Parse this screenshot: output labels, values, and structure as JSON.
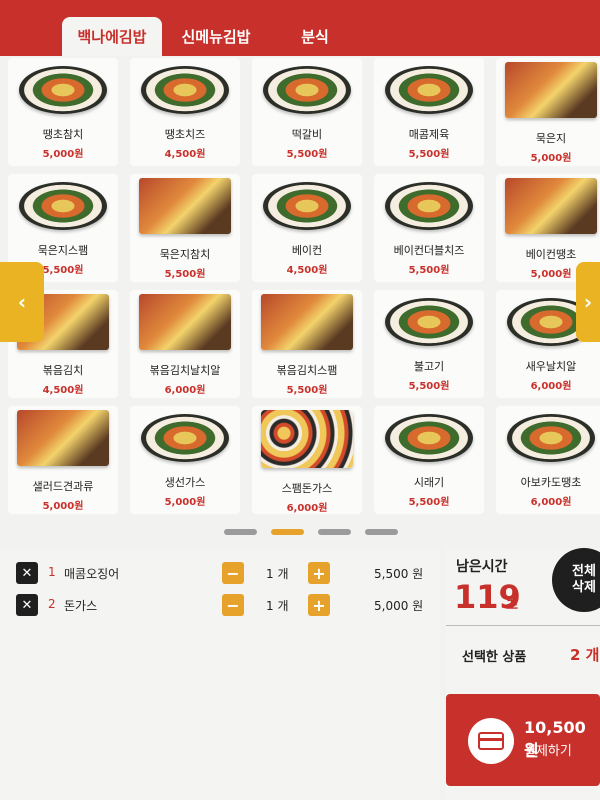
{
  "tabs": [
    {
      "label": "백나에김밥"
    },
    {
      "label": "신메뉴김밥"
    },
    {
      "label": "분식"
    }
  ],
  "menu": [
    {
      "name": "땡초참치",
      "price": "5,000원",
      "img": "roll"
    },
    {
      "name": "땡초치즈",
      "price": "4,500원",
      "img": "roll"
    },
    {
      "name": "떡갈비",
      "price": "5,500원",
      "img": "roll"
    },
    {
      "name": "매콤제육",
      "price": "5,500원",
      "img": "roll"
    },
    {
      "name": "묵은지",
      "price": "5,000원",
      "img": "rect"
    },
    {
      "name": "묵은지스팸",
      "price": "5,500원",
      "img": "roll"
    },
    {
      "name": "묵은지참치",
      "price": "5,500원",
      "img": "rect"
    },
    {
      "name": "베이컨",
      "price": "4,500원",
      "img": "roll"
    },
    {
      "name": "베이컨더블치즈",
      "price": "5,500원",
      "img": "roll"
    },
    {
      "name": "베이컨땡초",
      "price": "5,000원",
      "img": "rect"
    },
    {
      "name": "볶음김치",
      "price": "4,500원",
      "img": "rect"
    },
    {
      "name": "볶음김치날치알",
      "price": "6,000원",
      "img": "rect"
    },
    {
      "name": "볶음김치스팸",
      "price": "5,500원",
      "img": "rect"
    },
    {
      "name": "불고기",
      "price": "5,500원",
      "img": "roll"
    },
    {
      "name": "새우날치알",
      "price": "6,000원",
      "img": "roll"
    },
    {
      "name": "샐러드견과류",
      "price": "5,000원",
      "img": "rect"
    },
    {
      "name": "생선가스",
      "price": "5,000원",
      "img": "roll"
    },
    {
      "name": "스팸돈가스",
      "price": "6,000원",
      "img": "platter"
    },
    {
      "name": "시래기",
      "price": "5,500원",
      "img": "roll"
    },
    {
      "name": "아보카도땡초",
      "price": "6,000원",
      "img": "roll"
    }
  ],
  "pagination": {
    "active_index": 1
  },
  "order": [
    {
      "index": "1",
      "name": "매콤오징어",
      "qty": "1 개",
      "price": "5,500 원",
      "remove": "✕",
      "minus": "−",
      "plus": "+"
    },
    {
      "index": "2",
      "name": "돈가스",
      "qty": "1 개",
      "price": "5,000 원",
      "remove": "✕",
      "minus": "−",
      "plus": "+"
    }
  ],
  "summary": {
    "remaining_label": "남은시간",
    "remaining_value": "119",
    "remaining_unit": "초",
    "clear_all_line1": "전체",
    "clear_all_line2": "삭제",
    "selected_label": "선택한 상품",
    "selected_count": "2 개",
    "pay_amount": "10,500 원",
    "pay_label": "결제하기"
  },
  "arrows": {
    "left": "‹",
    "right": "›"
  },
  "colors": {
    "brand_red": "#c8312b",
    "accent_yellow": "#e6a22a"
  }
}
